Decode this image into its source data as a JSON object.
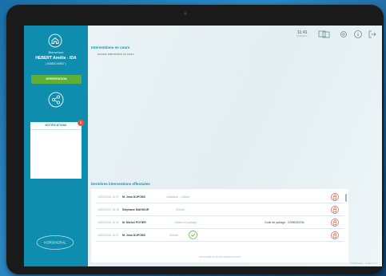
{
  "sidebar": {
    "welcome": "Bienvenue",
    "user_name": "HEBERT Amélie - IDA",
    "user_id": "( 80883149807 )",
    "action_button": "INTERVENTION",
    "notifications_title": "NOTIFICATIONS",
    "notifications_count": "1",
    "logo": "KORDOGRAL"
  },
  "topbar": {
    "time": "11:41",
    "date": "18/11/2021"
  },
  "current": {
    "title": "Interventions en cours",
    "empty_text": "Aucune intervention en cours"
  },
  "recent": {
    "title": "Dernières interventions effectuées",
    "rows": [
      {
        "datetime": "19/11/2021 10:37",
        "name": "M. Jean DUPOND",
        "action": "Validation - Clôture",
        "code": ""
      },
      {
        "datetime": "18/11/2021 15:18",
        "name": "Stéphane MAHIOUR",
        "action": "Clôture",
        "code": ""
      },
      {
        "datetime": "18/11/2021 10:11",
        "name": "M. Michel POTIER",
        "action": "Clôture et partage",
        "code": "Code de partage : C0R8152234"
      },
      {
        "datetime": "18/11/2021 10:27",
        "name": "M. Jean DUPOND",
        "action": "Clôture",
        "code": ""
      }
    ],
    "more_link": "AFFICHER PLUS D'INTERVENTIONS"
  },
  "footer": "KORDOGRAL - Version 2.7.1"
}
